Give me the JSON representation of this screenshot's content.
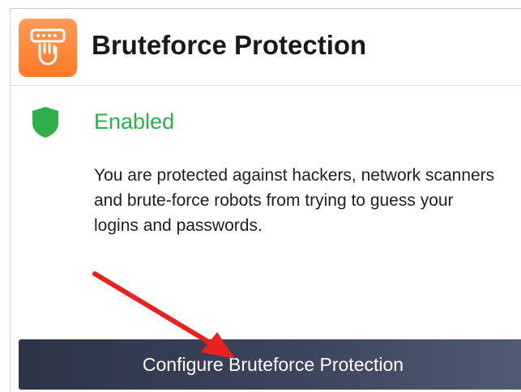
{
  "card": {
    "title": "Bruteforce Protection",
    "icon": "hand-shield-icon",
    "accent_color": "#ff8a3d"
  },
  "status": {
    "label": "Enabled",
    "icon": "green-shield-icon",
    "color": "#2eaf4a"
  },
  "description": "You are protected against hackers, network scanners and brute-force robots from trying to guess your logins and passwords.",
  "actions": {
    "configure_label": "Configure Bruteforce Protection"
  },
  "annotation": {
    "icon": "red-arrow-icon",
    "color": "#e8231f"
  }
}
